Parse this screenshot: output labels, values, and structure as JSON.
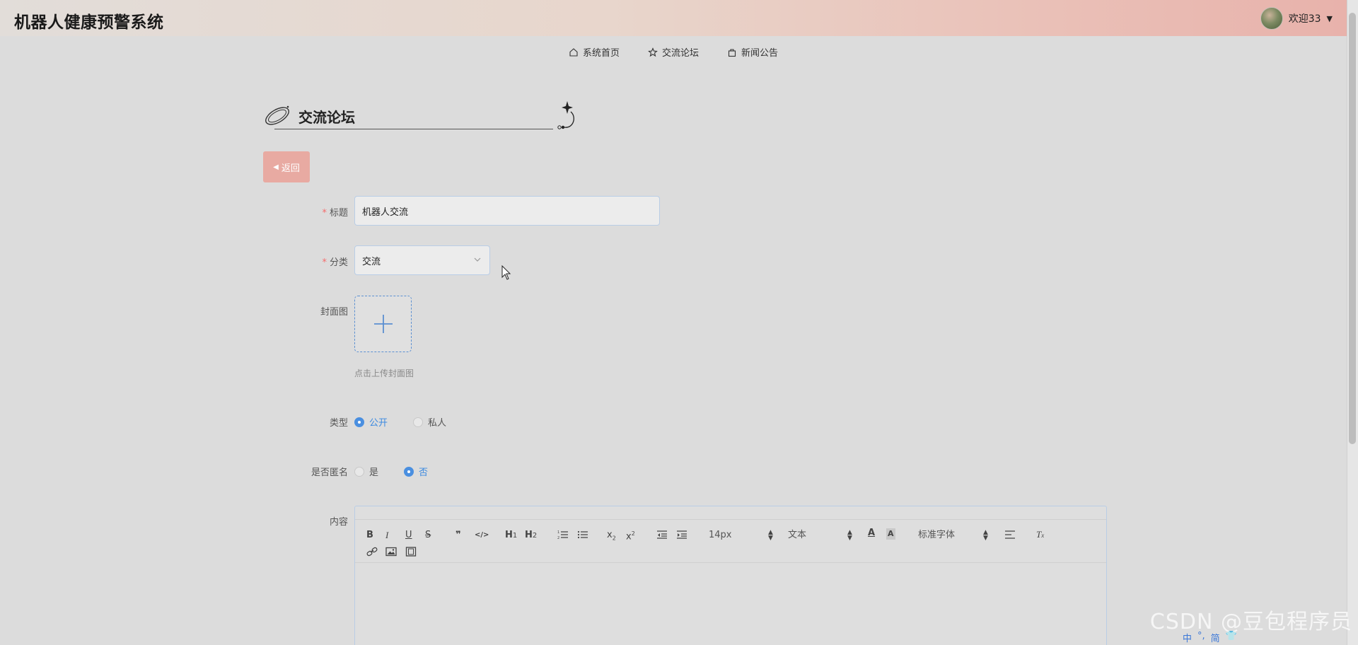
{
  "header": {
    "app_title": "机器人健康预警系统",
    "welcome_text": "欢迎33"
  },
  "nav": {
    "items": [
      {
        "label": "系统首页",
        "icon": "home-icon"
      },
      {
        "label": "交流论坛",
        "icon": "star-icon"
      },
      {
        "label": "新闻公告",
        "icon": "bag-icon"
      }
    ]
  },
  "page": {
    "section_title": "交流论坛",
    "back_label": "返回"
  },
  "form": {
    "title_label": "标题",
    "title_value": "机器人交流",
    "category_label": "分类",
    "category_value": "交流",
    "cover_label": "封面图",
    "cover_tip": "点击上传封面图",
    "type_label": "类型",
    "type_options": [
      "公开",
      "私人"
    ],
    "type_selected": "公开",
    "anonymous_label": "是否匿名",
    "anonymous_options": [
      "是",
      "否"
    ],
    "anonymous_selected": "否",
    "content_label": "内容"
  },
  "editor": {
    "size_value": "14px",
    "header_value": "文本",
    "font_value": "标准字体",
    "buttons": [
      "B",
      "I",
      "U",
      "S",
      "❞",
      "</>",
      "H1",
      "H2",
      "x2",
      "x2"
    ]
  },
  "colors": {
    "accent": "#4a8fe0",
    "back_button": "#e8aaa2",
    "required_mark": "#f56c6c"
  },
  "watermark": {
    "text": "CSDN @豆包程序员"
  },
  "ime": {
    "items": [
      "中",
      "°,",
      "简",
      "👕"
    ]
  }
}
